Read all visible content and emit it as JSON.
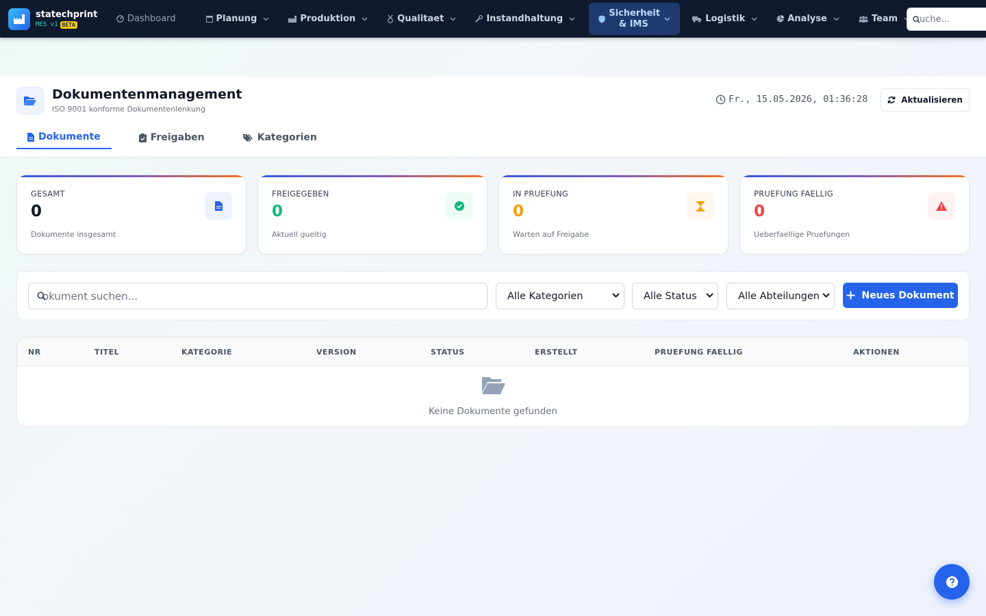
{
  "app": {
    "name": "statechprint",
    "version": "MES v1",
    "badge": "BETA"
  },
  "nav": {
    "items": [
      {
        "label": "Dashboard",
        "icon": "gauge-icon"
      },
      {
        "label": "Planung",
        "icon": "calendar-icon"
      },
      {
        "label": "Produktion",
        "icon": "factory-icon"
      },
      {
        "label": "Qualitaet",
        "icon": "medal-icon"
      },
      {
        "label": "Instandhaltung",
        "icon": "wrench-icon"
      },
      {
        "label_line1": "Sicherheit",
        "label_line2": "& IMS",
        "icon": "shield-icon",
        "active": true
      },
      {
        "label": "Logistik",
        "icon": "truck-icon"
      },
      {
        "label": "Analyse",
        "icon": "pie-chart-icon"
      },
      {
        "label": "Team",
        "icon": "users-icon"
      }
    ],
    "search_text": "uche..."
  },
  "page": {
    "title": "Dokumentenmanagement",
    "subtitle": "ISO 9001 konforme Dokumentenlenkung",
    "datetime": "Fr., 15.05.2026, 01:36:28",
    "refresh_label": "Aktualisieren",
    "tabs": [
      {
        "label": "Dokumente",
        "active": true
      },
      {
        "label": "Freigaben"
      },
      {
        "label": "Kategorien"
      }
    ]
  },
  "stats": [
    {
      "label": "GESAMT",
      "value": "0",
      "note": "Dokumente insgesamt",
      "color": "#111827",
      "icon": "document-icon"
    },
    {
      "label": "FREIGEGEBEN",
      "value": "0",
      "note": "Aktuell gueltig",
      "color": "#10b981",
      "icon": "check-circle-icon"
    },
    {
      "label": "IN PRUEFUNG",
      "value": "0",
      "note": "Warten auf Freigabe",
      "color": "#f59e0b",
      "icon": "hourglass-icon"
    },
    {
      "label": "PRUEFUNG FAELLIG",
      "value": "0",
      "note": "Ueberfaellige Pruefungen",
      "color": "#ef4444",
      "icon": "warning-icon"
    }
  ],
  "filters": {
    "search_text": "okument suchen...",
    "category": "Alle Kategorien",
    "status": "Alle Status",
    "department": "Alle Abteilungen",
    "new_button": "Neues Dokument"
  },
  "table": {
    "columns": [
      "NR",
      "TITEL",
      "KATEGORIE",
      "VERSION",
      "STATUS",
      "ERSTELLT",
      "PRUEFUNG FAELLIG",
      "AKTIONEN"
    ],
    "empty_text": "Keine Dokumente gefunden"
  },
  "colors": {
    "accent": "#2563eb",
    "nav_bg": "#0f1a2e"
  }
}
